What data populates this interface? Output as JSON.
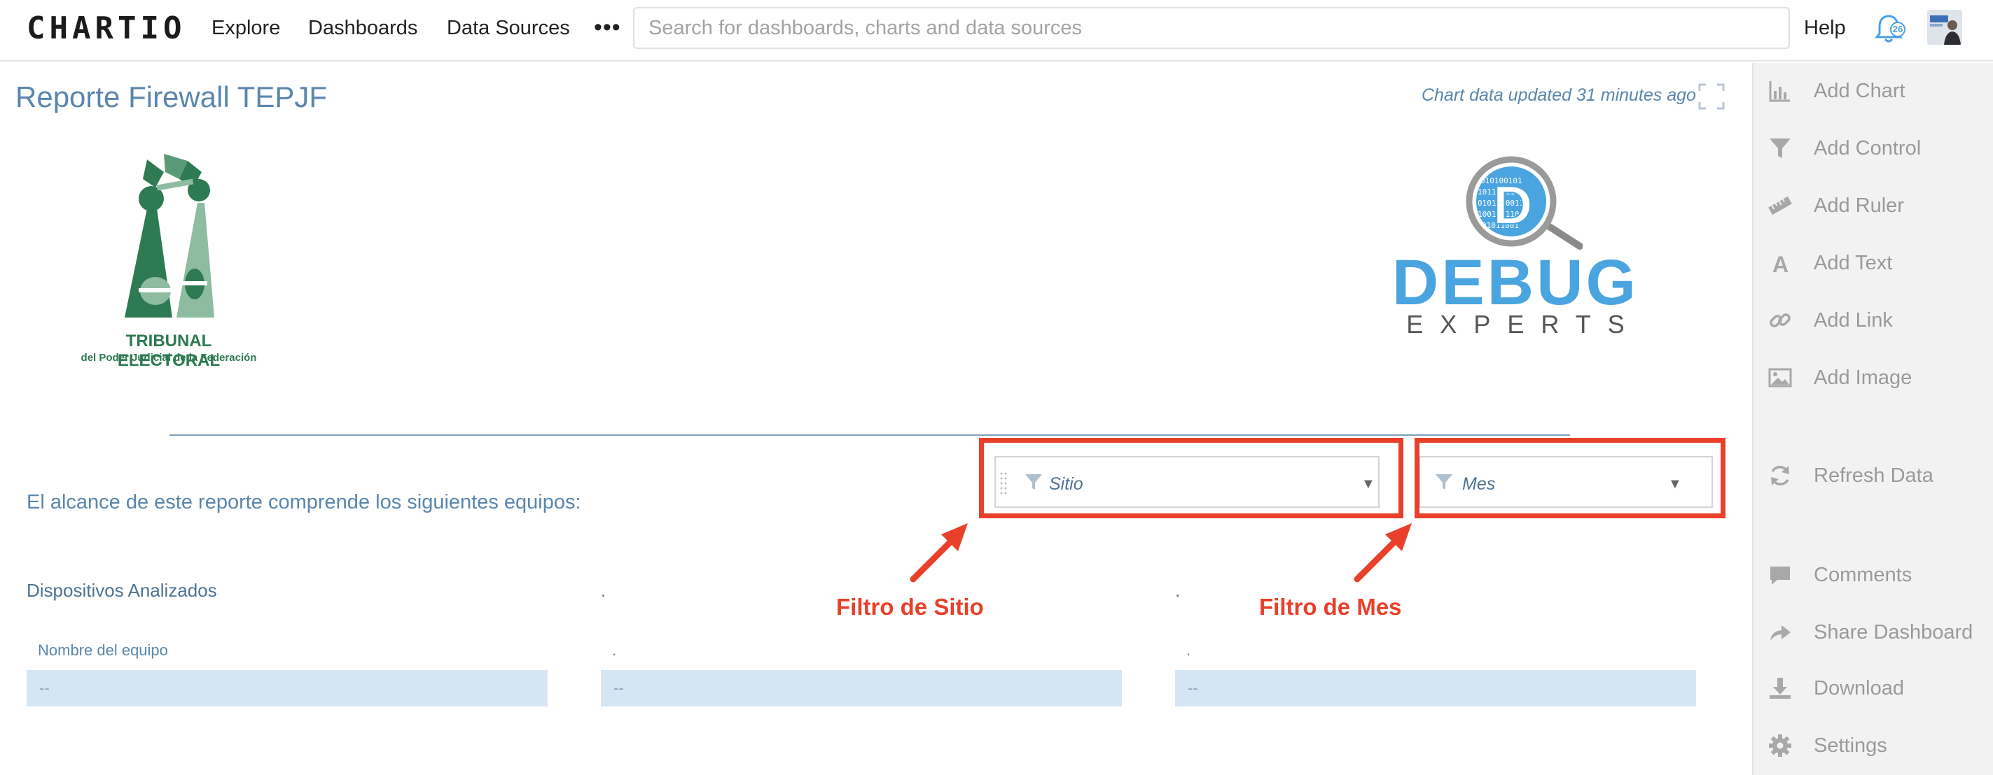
{
  "nav": {
    "logo": "CHARTIO",
    "items": [
      "Explore",
      "Dashboards",
      "Data Sources"
    ],
    "more": "•••",
    "search_placeholder": "Search for dashboards, charts and data sources",
    "help": "Help",
    "notification_count": "26"
  },
  "dashboard": {
    "title": "Reporte Firewall TEPJF",
    "updated": "Chart data updated 31 minutes ago",
    "tepjf_logo_line1": "TRIBUNAL ELECTORAL",
    "tepjf_logo_line2": "del Poder Judicial de la Federación",
    "debug_logo_word": "DEBUG",
    "debug_logo_sub": "EXPERTS",
    "scope_text": "El alcance de este reporte comprende los siguientes equipos:",
    "filters": [
      {
        "label": "Sitio"
      },
      {
        "label": "Mes"
      }
    ],
    "annotations": [
      "Filtro de Sitio",
      "Filtro de Mes"
    ],
    "columns": [
      {
        "title": "Dispositivos Analizados",
        "header": "Nombre del equipo",
        "value": "--"
      },
      {
        "title": ".",
        "header": ".",
        "value": "--"
      },
      {
        "title": ".",
        "header": ".",
        "value": "--"
      }
    ]
  },
  "sidebar": {
    "items": [
      {
        "label": "Add Chart",
        "icon": "bar-chart-icon"
      },
      {
        "label": "Add Control",
        "icon": "funnel-icon"
      },
      {
        "label": "Add Ruler",
        "icon": "ruler-icon"
      },
      {
        "label": "Add Text",
        "icon": "text-icon"
      },
      {
        "label": "Add Link",
        "icon": "link-icon"
      },
      {
        "label": "Add Image",
        "icon": "image-icon"
      },
      {
        "label": "Refresh Data",
        "icon": "refresh-icon"
      },
      {
        "label": "Comments",
        "icon": "comment-icon"
      },
      {
        "label": "Share Dashboard",
        "icon": "share-icon"
      },
      {
        "label": "Download",
        "icon": "download-icon"
      },
      {
        "label": "Settings",
        "icon": "gear-icon"
      }
    ]
  },
  "colors": {
    "accent_blue": "#5a86ad",
    "annotation_red": "#e8402a",
    "cell_bg": "#d6e5f4",
    "tepjf_green": "#2e7a52",
    "debug_blue": "#4aa4e0"
  }
}
